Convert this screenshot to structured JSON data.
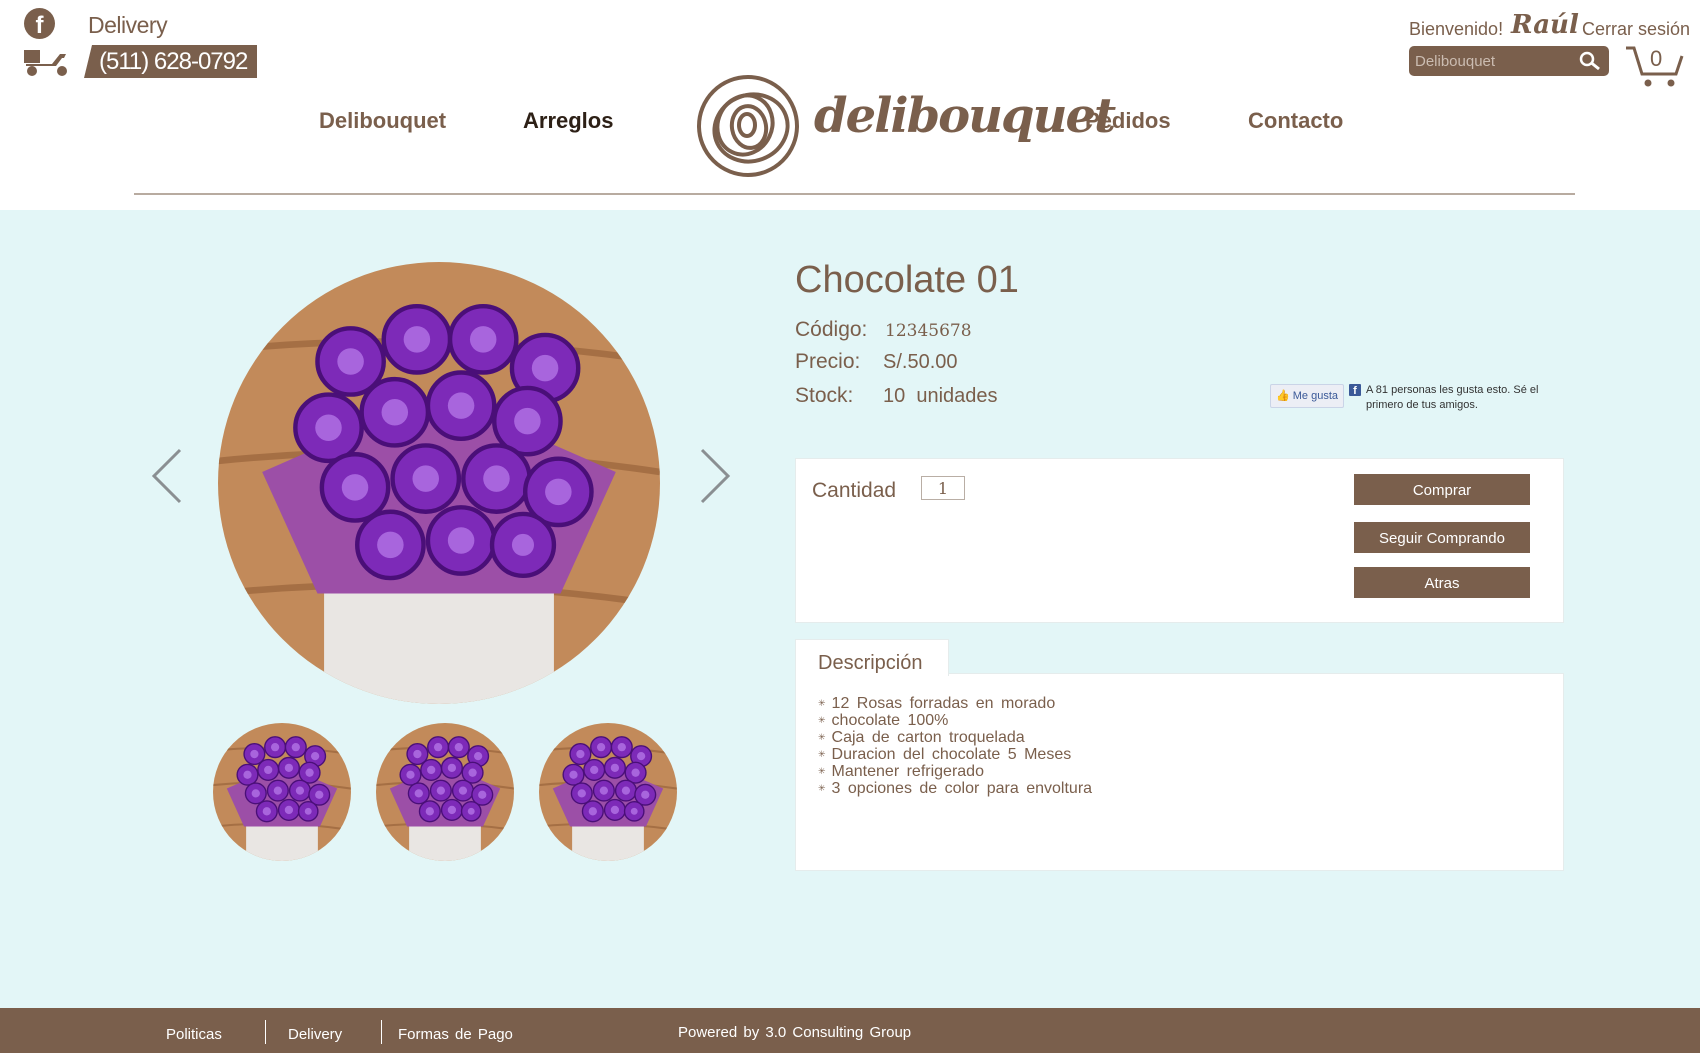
{
  "header": {
    "delivery_label": "Delivery",
    "phone": "(511) 628-0792",
    "welcome": "Bienvenido!",
    "user_name": "Raúl",
    "logout": "Cerrar sesión",
    "search_placeholder": "Delibouquet",
    "cart_count": "0",
    "logo_text": "delibouquet"
  },
  "nav": {
    "items": [
      {
        "label": "Delibouquet"
      },
      {
        "label": "Arreglos"
      },
      {
        "label": "Pedidos"
      },
      {
        "label": "Contacto"
      }
    ],
    "active": "Arreglos"
  },
  "product": {
    "title": "Chocolate 01",
    "code_label": "Código:",
    "code_value": "12345678",
    "price_label": "Precio:",
    "price_value": "S/.50.00",
    "stock_label": "Stock:",
    "stock_value": "10  unidades"
  },
  "like": {
    "button": "Me gusta",
    "text": "A 81 personas les gusta esto. Sé el primero de tus amigos."
  },
  "buy": {
    "qty_label": "Cantidad",
    "qty_value": "1",
    "buy_button": "Comprar",
    "continue_button": "Seguir Comprando",
    "back_button": "Atras"
  },
  "description": {
    "tab": "Descripción",
    "items": [
      "12 Rosas forradas en morado",
      "chocolate 100%",
      "Caja de carton troquelada",
      "Duracion del chocolate 5 Meses",
      "Mantener refrigerado",
      "3 opciones de color para envoltura"
    ]
  },
  "footer": {
    "links": [
      {
        "label": "Politicas"
      },
      {
        "label": "Delivery"
      },
      {
        "label": "Formas de Pago"
      }
    ],
    "powered": "Powered by 3.0 Consulting Group"
  },
  "colors": {
    "brand_brown": "#7a5f4c",
    "background": "#e3f6f7",
    "product_purple": "#7d2ab8"
  },
  "icons": [
    "facebook-icon",
    "scooter-icon",
    "search-icon",
    "cart-icon",
    "arrow-left-icon",
    "arrow-right-icon",
    "thumbs-up-icon"
  ]
}
